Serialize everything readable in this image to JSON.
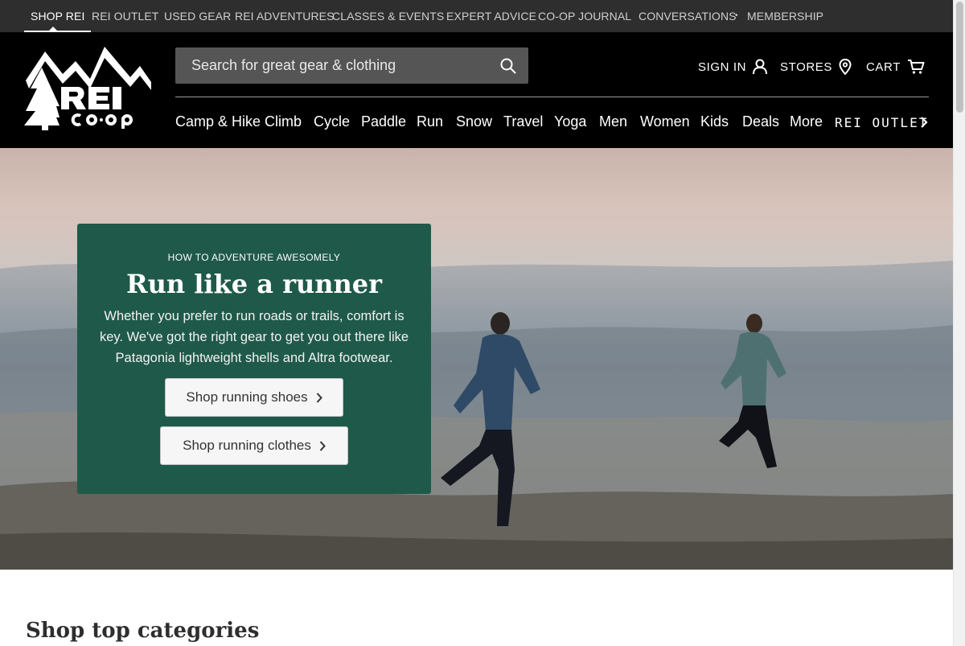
{
  "utility_nav": {
    "items": [
      "SHOP REI",
      "REI OUTLET",
      "USED GEAR",
      "REI ADVENTURES",
      "CLASSES & EVENTS",
      "EXPERT ADVICE",
      "CO-OP JOURNAL",
      "CONVERSATIONS",
      "MEMBERSHIP"
    ],
    "separator": "•",
    "active": "SHOP REI"
  },
  "header": {
    "search_placeholder": "Search for great gear & clothing",
    "sign_in": "SIGN IN",
    "stores": "STORES",
    "cart": "CART"
  },
  "category_nav": {
    "items": [
      "Camp & Hike",
      "Climb",
      "Cycle",
      "Paddle",
      "Run",
      "Snow",
      "Travel",
      "Yoga",
      "Men",
      "Women",
      "Kids",
      "Deals",
      "More"
    ],
    "outlet": "REI OUTLET"
  },
  "hero": {
    "eyebrow": "HOW TO ADVENTURE AWESOMELY",
    "headline": "Run like a runner",
    "body": "Whether you prefer to run roads or trails, comfort is key. We've got the right gear to get you out there like Patagonia lightweight shells and Altra footwear.",
    "buttons": [
      "Shop running shoes",
      "Shop running clothes"
    ]
  },
  "sections": {
    "top_categories_title": "Shop top categories"
  },
  "colors": {
    "utility_bar": "#2e2e2e",
    "header": "#000000",
    "search_box": "#555555",
    "promo_panel": "#1f5949"
  }
}
